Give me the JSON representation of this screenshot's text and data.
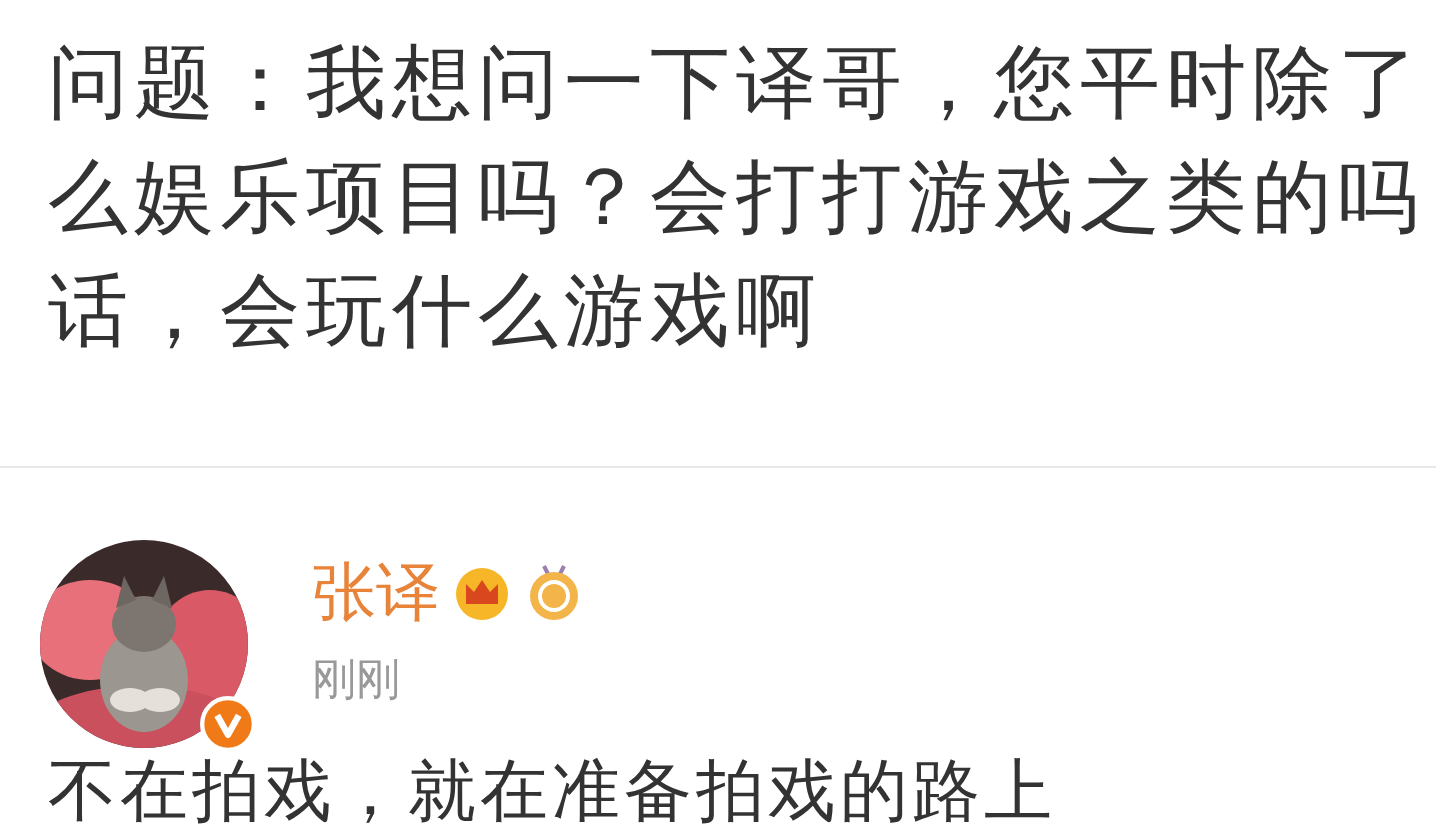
{
  "question": {
    "lines": [
      "问题：我想问一下译哥，您平时除了",
      "么娱乐项目吗？会打打游戏之类的吗",
      "话，会玩什么游戏啊"
    ]
  },
  "reply": {
    "avatar": {
      "kind": "picture",
      "verified": true
    },
    "name": "张译",
    "time": "刚刚",
    "text": "不在拍戏，就在准备拍戏的路上"
  }
}
